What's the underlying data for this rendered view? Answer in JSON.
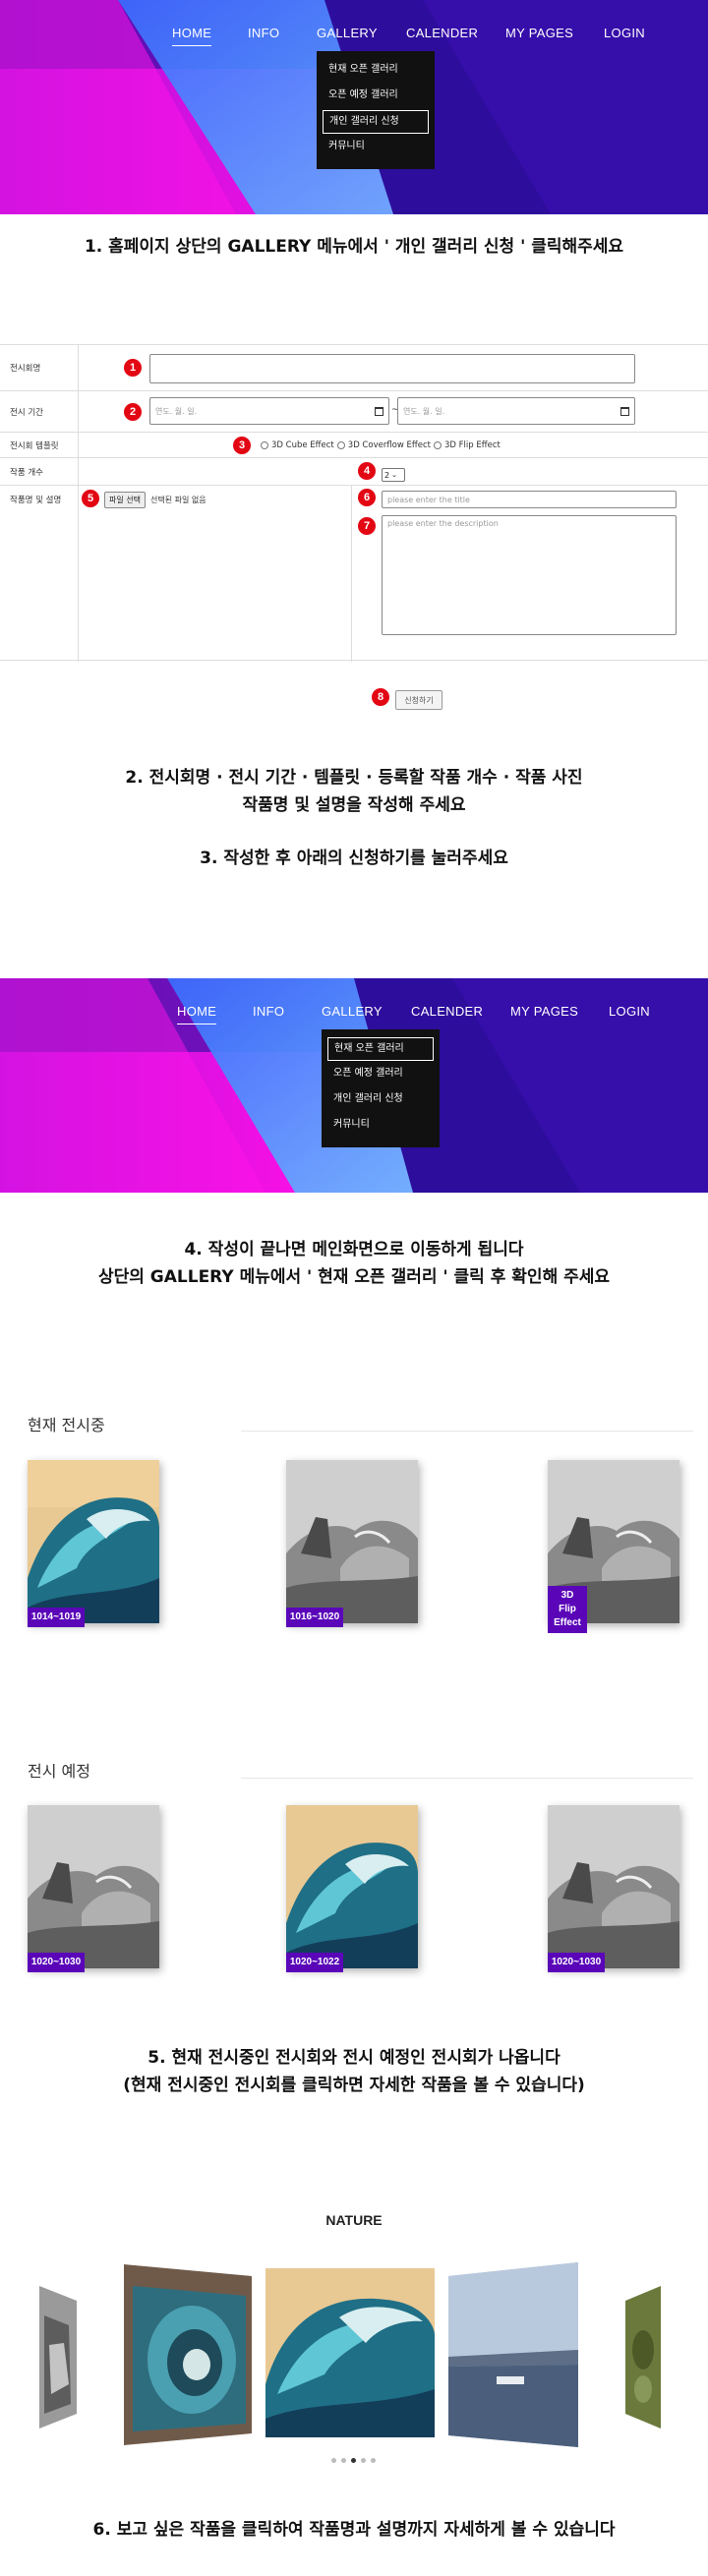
{
  "nav": {
    "home": "HOME",
    "info": "INFO",
    "gallery": "GALLERY",
    "calender": "CALENDER",
    "my_pages": "MY PAGES",
    "login": "LOGIN"
  },
  "gallery_menu": [
    "현재 오픈 갤러리",
    "오픈 예정 갤러리",
    "개인 갤러리 신청",
    "커뮤니티"
  ],
  "steps": {
    "step1": "1.  홈페이지 상단의 GALLERY 메뉴에서 ' 개인 갤러리 신청 ' 클릭해주세요",
    "step2_line1": "2.  전시회명 · 전시 기간 · 템플릿 · 등록할 작품 개수 · 작품 사진",
    "step2_line2": "작품명 및 설명을 작성해 주세요",
    "step3": "3.  작성한 후 아래의 신청하기를 눌러주세요",
    "step4_line1": "4.  작성이 끝나면 메인화면으로 이동하게 됩니다",
    "step4_line2": "상단의 GALLERY 메뉴에서 ' 현재 오픈 갤러리 ' 클릭 후 확인해 주세요",
    "step5_line1": "5.  현재 전시중인 전시회와 전시 예정인 전시회가 나옵니다",
    "step5_line2": "(현재 전시중인 전시회를 클릭하면 자세한 작품을 볼 수 있습니다)",
    "step6": "6.  보고 싶은 작품을 클릭하여 작품명과 설명까지 자세하게 볼 수 있습니다"
  },
  "form": {
    "labels": {
      "exhibition_name": "전시회명",
      "period": "전시 기간",
      "template": "전시회 템플릿",
      "count": "작품 개수",
      "artwork": "작품명 및 설명"
    },
    "date_placeholder": "연도. 월. 일.",
    "date_separator": "~",
    "template_options": [
      "3D Cube Effect",
      "3D Coverflow Effect",
      "3D Flip Effect"
    ],
    "count_value": "2",
    "file_button": "파일 선택",
    "file_status": "선택된 파일 없음",
    "title_placeholder": "please enter the title",
    "description_placeholder": "please enter the description",
    "submit": "신청하기",
    "badges": [
      "1",
      "2",
      "3",
      "4",
      "5",
      "6",
      "7",
      "8"
    ]
  },
  "gallery": {
    "current_title": "현재 전시중",
    "upcoming_title": "전시 예정",
    "current": [
      {
        "label": "1014~1019",
        "image": "wave"
      },
      {
        "label": "1016~1020",
        "image": "rock"
      },
      {
        "label": "3D Flip Effect",
        "image": "rock"
      }
    ],
    "upcoming": [
      {
        "label": "1020~1030",
        "image": "rock"
      },
      {
        "label": "1020~1022",
        "image": "wave"
      },
      {
        "label": "1020~1030",
        "image": "rock"
      }
    ],
    "flip_lines": [
      "3D",
      "Flip",
      "Effect"
    ]
  },
  "carousel": {
    "title": "NATURE",
    "slides": [
      "rock",
      "wave-mosaic",
      "wave",
      "harbor",
      "green-relief"
    ],
    "active_index": 2,
    "dot_count": 5
  },
  "colors": {
    "badge": "#e30613",
    "label_purple": "#5a06b8",
    "hero_pink": "#ff10e6",
    "hero_blue": "#2f74ff",
    "hero_purple": "#3d0aa8"
  }
}
